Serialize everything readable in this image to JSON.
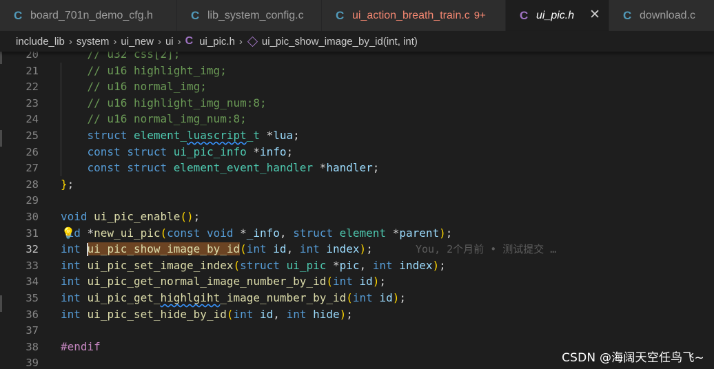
{
  "tabs": [
    {
      "icon": "C",
      "name": "board_701n_demo_cfg.h",
      "count": "",
      "active": false,
      "warn": false,
      "width": 257
    },
    {
      "icon": "C",
      "name": "lib_system_config.c",
      "count": "",
      "active": false,
      "warn": false,
      "width": 210
    },
    {
      "icon": "C",
      "name": "ui_action_breath_train.c",
      "count": "9+",
      "active": false,
      "warn": true,
      "width": 267
    },
    {
      "icon": "C",
      "name": "ui_pic.h",
      "count": "",
      "active": true,
      "warn": false,
      "width": 150
    },
    {
      "icon": "C",
      "name": "download.c",
      "count": "",
      "active": false,
      "warn": false,
      "width": 160
    }
  ],
  "tab_close_label": "✕",
  "breadcrumb": {
    "folders": [
      "include_lib",
      "system",
      "ui_new",
      "ui"
    ],
    "file_icon": "C",
    "file": "ui_pic.h",
    "symbol_icon": "symbol-method-icon",
    "symbol": "ui_pic_show_image_by_id(int, int)"
  },
  "editor": {
    "current_line": 32,
    "lines": [
      {
        "n": 20,
        "tokens": [
          [
            "cm",
            "    // u32 css[2];"
          ]
        ]
      },
      {
        "n": 21,
        "tokens": [
          [
            "cm",
            "    // u16 highlight_img;"
          ]
        ]
      },
      {
        "n": 22,
        "tokens": [
          [
            "cm",
            "    // u16 normal_img;"
          ]
        ]
      },
      {
        "n": 23,
        "tokens": [
          [
            "cm",
            "    // u16 highlight_img_num:8;"
          ]
        ]
      },
      {
        "n": 24,
        "tokens": [
          [
            "cm",
            "    // u16 normal_img_num:8;"
          ]
        ]
      },
      {
        "n": 25,
        "tokens": [
          [
            "p",
            "    "
          ],
          [
            "kw",
            "struct"
          ],
          [
            "p",
            " "
          ],
          [
            "ty",
            "element_"
          ],
          [
            "ty",
            "luascript",
            "squig"
          ],
          [
            "ty",
            "_t"
          ],
          [
            "p",
            " *"
          ],
          [
            "var",
            "lua"
          ],
          [
            "p",
            ";"
          ]
        ]
      },
      {
        "n": 26,
        "tokens": [
          [
            "p",
            "    "
          ],
          [
            "kw",
            "const"
          ],
          [
            "p",
            " "
          ],
          [
            "kw",
            "struct"
          ],
          [
            "p",
            " "
          ],
          [
            "ty",
            "ui_pic_info"
          ],
          [
            "p",
            " *"
          ],
          [
            "var",
            "info"
          ],
          [
            "p",
            ";"
          ]
        ]
      },
      {
        "n": 27,
        "tokens": [
          [
            "p",
            "    "
          ],
          [
            "kw",
            "const"
          ],
          [
            "p",
            " "
          ],
          [
            "kw",
            "struct"
          ],
          [
            "p",
            " "
          ],
          [
            "ty",
            "element_event_handler"
          ],
          [
            "p",
            " *"
          ],
          [
            "var",
            "handler"
          ],
          [
            "p",
            ";"
          ]
        ]
      },
      {
        "n": 28,
        "tokens": [
          [
            "br1",
            "}"
          ],
          [
            "p",
            ";"
          ]
        ]
      },
      {
        "n": 29,
        "tokens": []
      },
      {
        "n": 30,
        "tokens": [
          [
            "kw",
            "void"
          ],
          [
            "p",
            " "
          ],
          [
            "fn",
            "ui_pic_enable"
          ],
          [
            "br1",
            "()"
          ],
          [
            "p",
            ";"
          ]
        ]
      },
      {
        "n": 31,
        "bulb": true,
        "tokens": [
          [
            "kw",
            " id"
          ],
          [
            "p",
            " *"
          ],
          [
            "fn",
            "new_ui_pic"
          ],
          [
            "br1",
            "("
          ],
          [
            "kw",
            "const"
          ],
          [
            "p",
            " "
          ],
          [
            "kw",
            "void"
          ],
          [
            "p",
            " *"
          ],
          [
            "var",
            "_info"
          ],
          [
            "p",
            ", "
          ],
          [
            "kw",
            "struct"
          ],
          [
            "p",
            " "
          ],
          [
            "ty",
            "element"
          ],
          [
            "p",
            " *"
          ],
          [
            "var",
            "parent"
          ],
          [
            "br1",
            ")"
          ],
          [
            "p",
            ";"
          ]
        ]
      },
      {
        "n": 32,
        "current": true,
        "tokens": [
          [
            "kw",
            "int"
          ],
          [
            "p",
            " "
          ],
          [
            "fn",
            "ui_pic_show_image_by_id",
            "sel"
          ],
          [
            "br1",
            "("
          ],
          [
            "kw",
            "int"
          ],
          [
            "p",
            " "
          ],
          [
            "var",
            "id"
          ],
          [
            "p",
            ", "
          ],
          [
            "kw",
            "int"
          ],
          [
            "p",
            " "
          ],
          [
            "var",
            "index"
          ],
          [
            "br1",
            ")"
          ],
          [
            "p",
            ";"
          ]
        ],
        "blame": "You, 2个月前 • 测试提交 …"
      },
      {
        "n": 33,
        "tokens": [
          [
            "kw",
            "int"
          ],
          [
            "p",
            " "
          ],
          [
            "fn",
            "ui_pic_set_image_index"
          ],
          [
            "br1",
            "("
          ],
          [
            "kw",
            "struct"
          ],
          [
            "p",
            " "
          ],
          [
            "ty",
            "ui_pic"
          ],
          [
            "p",
            " *"
          ],
          [
            "var",
            "pic"
          ],
          [
            "p",
            ", "
          ],
          [
            "kw",
            "int"
          ],
          [
            "p",
            " "
          ],
          [
            "var",
            "index"
          ],
          [
            "br1",
            ")"
          ],
          [
            "p",
            ";"
          ]
        ]
      },
      {
        "n": 34,
        "tokens": [
          [
            "kw",
            "int"
          ],
          [
            "p",
            " "
          ],
          [
            "fn",
            "ui_pic_get_normal_image_number_by_id"
          ],
          [
            "br1",
            "("
          ],
          [
            "kw",
            "int"
          ],
          [
            "p",
            " "
          ],
          [
            "var",
            "id"
          ],
          [
            "br1",
            ")"
          ],
          [
            "p",
            ";"
          ]
        ]
      },
      {
        "n": 35,
        "tokens": [
          [
            "kw",
            "int"
          ],
          [
            "p",
            " "
          ],
          [
            "fn",
            "ui_pic_get_"
          ],
          [
            "fn",
            "highlgiht",
            "squig"
          ],
          [
            "fn",
            "_image_number_by_id"
          ],
          [
            "br1",
            "("
          ],
          [
            "kw",
            "int"
          ],
          [
            "p",
            " "
          ],
          [
            "var",
            "id"
          ],
          [
            "br1",
            ")"
          ],
          [
            "p",
            ";"
          ]
        ]
      },
      {
        "n": 36,
        "tokens": [
          [
            "kw",
            "int"
          ],
          [
            "p",
            " "
          ],
          [
            "fn",
            "ui_pic_set_hide_by_id"
          ],
          [
            "br1",
            "("
          ],
          [
            "kw",
            "int"
          ],
          [
            "p",
            " "
          ],
          [
            "var",
            "id"
          ],
          [
            "p",
            ", "
          ],
          [
            "kw",
            "int"
          ],
          [
            "p",
            " "
          ],
          [
            "var",
            "hide"
          ],
          [
            "br1",
            ")"
          ],
          [
            "p",
            ";"
          ]
        ]
      },
      {
        "n": 37,
        "tokens": []
      },
      {
        "n": 38,
        "tokens": [
          [
            "pp",
            "#endif"
          ]
        ]
      },
      {
        "n": 39,
        "tokens": []
      }
    ]
  },
  "watermark": "CSDN @海阔天空任鸟飞~"
}
